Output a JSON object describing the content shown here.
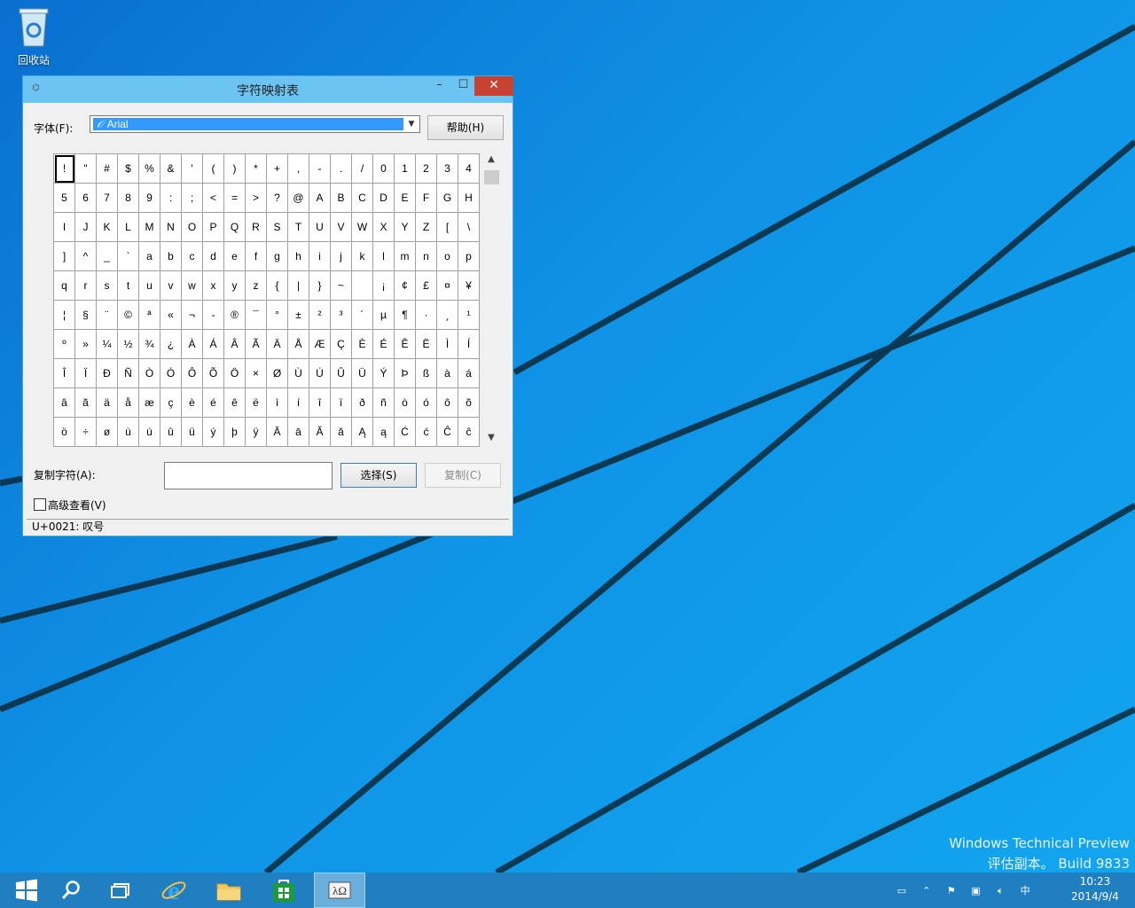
{
  "desktop": {
    "recycle_bin_label": "回收站",
    "watermark_line1": "Windows Technical Preview",
    "watermark_line2": "评估副本。 Build 9833"
  },
  "window": {
    "title": "字符映射表",
    "minimize": "–",
    "maximize": "☐",
    "close": "✕",
    "font_label": "字体(F):",
    "font_value": "Arial",
    "font_type_marker": "𝒪",
    "help_button": "帮助(H)",
    "grid_rows": [
      [
        "!",
        "\"",
        "#",
        "$",
        "%",
        "&",
        "'",
        "(",
        ")",
        "*",
        "+",
        ",",
        "-",
        ".",
        "/",
        "0",
        "1",
        "2",
        "3",
        "4"
      ],
      [
        "5",
        "6",
        "7",
        "8",
        "9",
        ":",
        ";",
        "<",
        "=",
        ">",
        "?",
        "@",
        "A",
        "B",
        "C",
        "D",
        "E",
        "F",
        "G",
        "H"
      ],
      [
        "I",
        "J",
        "K",
        "L",
        "M",
        "N",
        "O",
        "P",
        "Q",
        "R",
        "S",
        "T",
        "U",
        "V",
        "W",
        "X",
        "Y",
        "Z",
        "[",
        "\\"
      ],
      [
        "]",
        "^",
        "_",
        "`",
        "a",
        "b",
        "c",
        "d",
        "e",
        "f",
        "g",
        "h",
        "i",
        "j",
        "k",
        "l",
        "m",
        "n",
        "o",
        "p"
      ],
      [
        "q",
        "r",
        "s",
        "t",
        "u",
        "v",
        "w",
        "x",
        "y",
        "z",
        "{",
        "|",
        "}",
        "~",
        " ",
        "¡",
        "¢",
        "£",
        "¤",
        "¥"
      ],
      [
        "¦",
        "§",
        "¨",
        "©",
        "ª",
        "«",
        "¬",
        "-",
        "®",
        "¯",
        "°",
        "±",
        "²",
        "³",
        "´",
        "µ",
        "¶",
        "·",
        "¸",
        "¹"
      ],
      [
        "º",
        "»",
        "¼",
        "½",
        "¾",
        "¿",
        "À",
        "Á",
        "Â",
        "Ã",
        "Ä",
        "Å",
        "Æ",
        "Ç",
        "È",
        "É",
        "Ê",
        "Ë",
        "Ì",
        "Í"
      ],
      [
        "Î",
        "Ï",
        "Ð",
        "Ñ",
        "Ò",
        "Ó",
        "Ô",
        "Õ",
        "Ö",
        "×",
        "Ø",
        "Ù",
        "Ú",
        "Û",
        "Ü",
        "Ý",
        "Þ",
        "ß",
        "à",
        "á"
      ],
      [
        "â",
        "ã",
        "ä",
        "å",
        "æ",
        "ç",
        "è",
        "é",
        "ê",
        "ë",
        "ì",
        "í",
        "î",
        "ï",
        "ð",
        "ñ",
        "ò",
        "ó",
        "ô",
        "õ"
      ],
      [
        "ö",
        "÷",
        "ø",
        "ù",
        "ú",
        "û",
        "ü",
        "ý",
        "þ",
        "ÿ",
        "Ā",
        "ā",
        "Ă",
        "ă",
        "Ą",
        "ą",
        "Ć",
        "ć",
        "Ĉ",
        "ĉ"
      ]
    ],
    "copy_label": "复制字符(A):",
    "copy_value": "",
    "select_button": "选择(S)",
    "copy_button": "复制(C)",
    "advanced_view_label": "高级查看(V)",
    "status_text": "U+0021: 叹号"
  },
  "taskbar": {
    "time": "10:23",
    "date": "2014/9/4",
    "ime": "中",
    "items": [
      "start-icon",
      "search-icon",
      "task-view-icon",
      "internet-explorer-icon",
      "file-explorer-icon",
      "store-icon",
      "character-map-icon"
    ]
  },
  "colors": {
    "title_bar": "#6cc4f2",
    "close_button": "#c84232",
    "selection": "#3399ff",
    "taskbar": "#1f7fc0"
  }
}
